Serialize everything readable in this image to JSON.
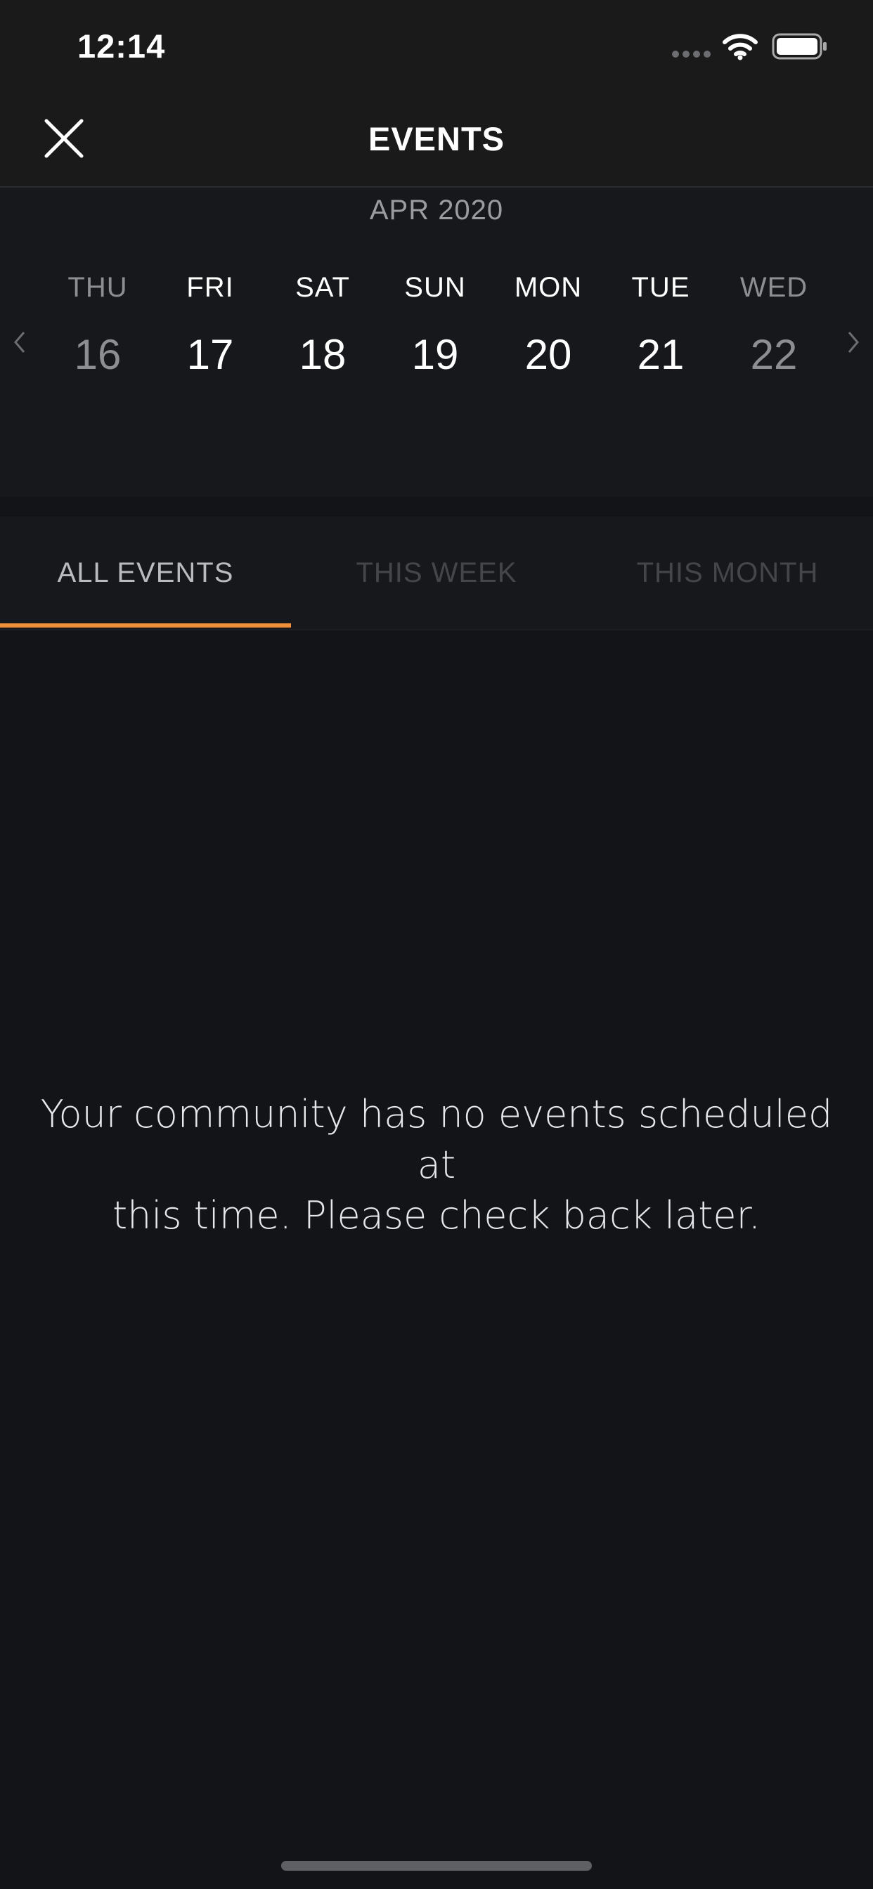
{
  "status_bar": {
    "time": "12:14"
  },
  "header": {
    "title": "EVENTS"
  },
  "calendar": {
    "month": "APR 2020",
    "days": [
      {
        "dow": "THU",
        "num": "16",
        "dim": true
      },
      {
        "dow": "FRI",
        "num": "17",
        "dim": false
      },
      {
        "dow": "SAT",
        "num": "18",
        "dim": false
      },
      {
        "dow": "SUN",
        "num": "19",
        "dim": false
      },
      {
        "dow": "MON",
        "num": "20",
        "dim": false
      },
      {
        "dow": "TUE",
        "num": "21",
        "dim": false
      },
      {
        "dow": "WED",
        "num": "22",
        "dim": true
      }
    ]
  },
  "tabs": [
    {
      "label": "ALL EVENTS",
      "active": true
    },
    {
      "label": "THIS WEEK",
      "active": false
    },
    {
      "label": "THIS MONTH",
      "active": false
    }
  ],
  "empty_state": {
    "line1": "Your community has no events scheduled at",
    "line2": "this time. Please check back later."
  },
  "colors": {
    "accent": "#f08f3a",
    "background": "#121417",
    "header_bg": "#1a1a1b"
  },
  "icons": [
    "close-icon",
    "signal-icon",
    "wifi-icon",
    "battery-icon",
    "chevron-left-icon",
    "chevron-right-icon"
  ]
}
